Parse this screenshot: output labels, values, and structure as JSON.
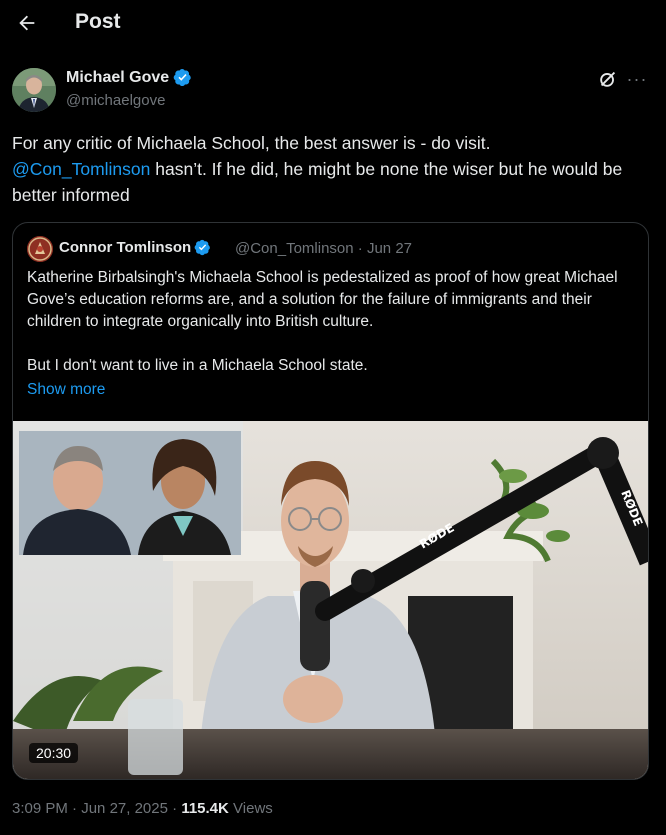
{
  "header": {
    "title": "Post"
  },
  "post": {
    "author_name": "Michael Gove",
    "author_handle": "@michaelgove",
    "text_before": "For any critic of Michaela School, the best answer is - do visit.",
    "mention": "@Con_Tomlinson",
    "text_after": " hasn’t. If he did, he might be none the wiser but he would be better informed"
  },
  "quote": {
    "author_name": "Connor Tomlinson",
    "author_handle": "@Con_Tomlinson",
    "date": "Jun 27",
    "meta_separator": "·",
    "paragraph1": "Katherine Birbalsingh's Michaela School is pedestalized as proof of how great Michael Gove’s education reforms are, and a solution for the failure of immigrants and their children to integrate organically into British culture.",
    "paragraph2": "But I don't want to live in a Michaela School state.",
    "show_more": "Show more",
    "video": {
      "duration": "20:30",
      "mic_brand": "RØDE"
    }
  },
  "footer": {
    "time": "3:09 PM",
    "separator": "·",
    "date": "Jun 27, 2025",
    "views_count": "115.4K",
    "views_label": "Views"
  },
  "colors": {
    "accent": "#1d9bf0",
    "muted": "#71767b",
    "text": "#e7e9ea",
    "border": "#2f3336"
  }
}
